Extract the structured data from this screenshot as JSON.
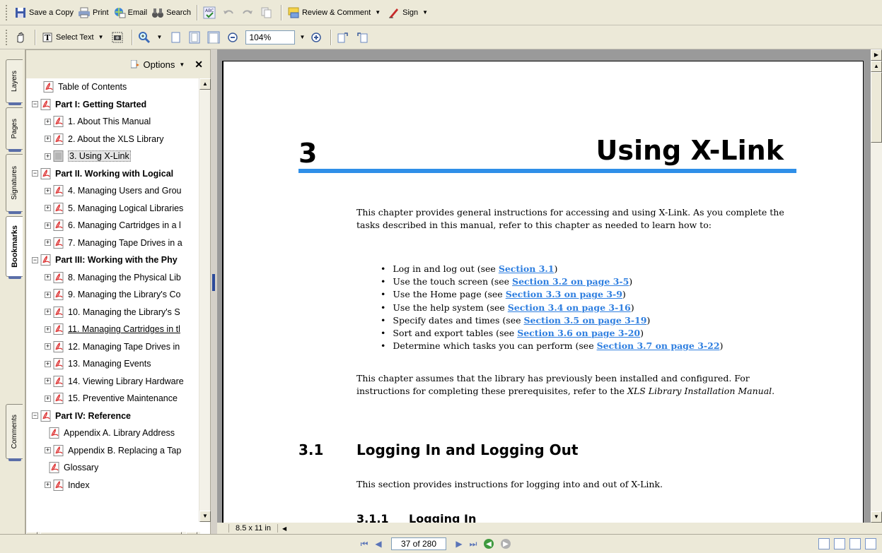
{
  "toolbar1": {
    "save_copy": "Save a Copy",
    "print": "Print",
    "email": "Email",
    "search": "Search",
    "review": "Review & Comment",
    "sign": "Sign"
  },
  "toolbar2": {
    "select_text": "Select Text",
    "zoom": "104%"
  },
  "nav_tabs": [
    "Layers",
    "Pages",
    "Signatures",
    "Bookmarks",
    "Comments"
  ],
  "panel": {
    "options_label": "Options",
    "bookmarks": [
      {
        "label": "Table of Contents",
        "level": "leaf-top"
      },
      {
        "label": "Part I: Getting Started",
        "level": "top"
      },
      {
        "label": "1. About This Manual",
        "level": "child"
      },
      {
        "label": "2. About the XLS Library",
        "level": "child"
      },
      {
        "label": "3. Using X-Link",
        "level": "child",
        "state": "selected"
      },
      {
        "label": "Part II. Working with Logical",
        "level": "top"
      },
      {
        "label": "4. Managing Users and Grou",
        "level": "child"
      },
      {
        "label": "5. Managing Logical Libraries",
        "level": "child"
      },
      {
        "label": "6. Managing Cartridges in a l",
        "level": "child"
      },
      {
        "label": "7. Managing Tape Drives in a",
        "level": "child"
      },
      {
        "label": "Part III: Working with the Phy",
        "level": "top"
      },
      {
        "label": "8. Managing the Physical Lib",
        "level": "child"
      },
      {
        "label": "9. Managing the Library's Co",
        "level": "child"
      },
      {
        "label": "10. Managing the Library's S",
        "level": "child"
      },
      {
        "label": "11. Managing Cartridges in tl",
        "level": "child",
        "state": "underlined"
      },
      {
        "label": "12. Managing Tape Drives in",
        "level": "child"
      },
      {
        "label": "13. Managing Events",
        "level": "child"
      },
      {
        "label": "14. Viewing Library Hardware",
        "level": "child"
      },
      {
        "label": "15. Preventive Maintenance",
        "level": "child"
      },
      {
        "label": "Part IV: Reference",
        "level": "top"
      },
      {
        "label": "Appendix A. Library Address",
        "level": "leaf"
      },
      {
        "label": "Appendix B. Replacing a Tap",
        "level": "child"
      },
      {
        "label": "Glossary",
        "level": "leaf"
      },
      {
        "label": "Index",
        "level": "child"
      }
    ]
  },
  "document": {
    "chapter_number": "3",
    "chapter_title": "Using X-Link",
    "intro": "This chapter provides general instructions for accessing and using X-Link. As you complete the tasks described in this manual, refer to this chapter as needed to learn how to:",
    "bullets": [
      {
        "text": "Log in and log out (see ",
        "link": "Section 3.1",
        "tail": ")"
      },
      {
        "text": "Use the touch screen (see ",
        "link": "Section 3.2 on page 3-5",
        "tail": ")"
      },
      {
        "text": "Use the Home page (see ",
        "link": "Section 3.3 on page 3-9",
        "tail": ")"
      },
      {
        "text": "Use the help system (see ",
        "link": "Section 3.4 on page 3-16",
        "tail": ")"
      },
      {
        "text": "Specify dates and times (see ",
        "link": "Section 3.5 on page 3-19",
        "tail": ")"
      },
      {
        "text": "Sort and export tables (see ",
        "link": "Section 3.6 on page 3-20",
        "tail": ")"
      },
      {
        "text": "Determine which tasks you can perform (see ",
        "link": "Section 3.7 on page 3-22",
        "tail": ")"
      }
    ],
    "assumes_text": "This chapter assumes that the library has previously been installed and configured. For instructions for completing these prerequisites, refer to the ",
    "assumes_italic": "XLS Library Installation Manual",
    "assumes_end": ".",
    "section_num": "3.1",
    "section_title": "Logging In and Logging Out",
    "section_para": "This section provides instructions for logging into and out of X-Link.",
    "subsection_num": "3.1.1",
    "subsection_title": "Logging In",
    "page_size": "8.5 x 11 in"
  },
  "status": {
    "page_indicator": "37 of 280"
  }
}
